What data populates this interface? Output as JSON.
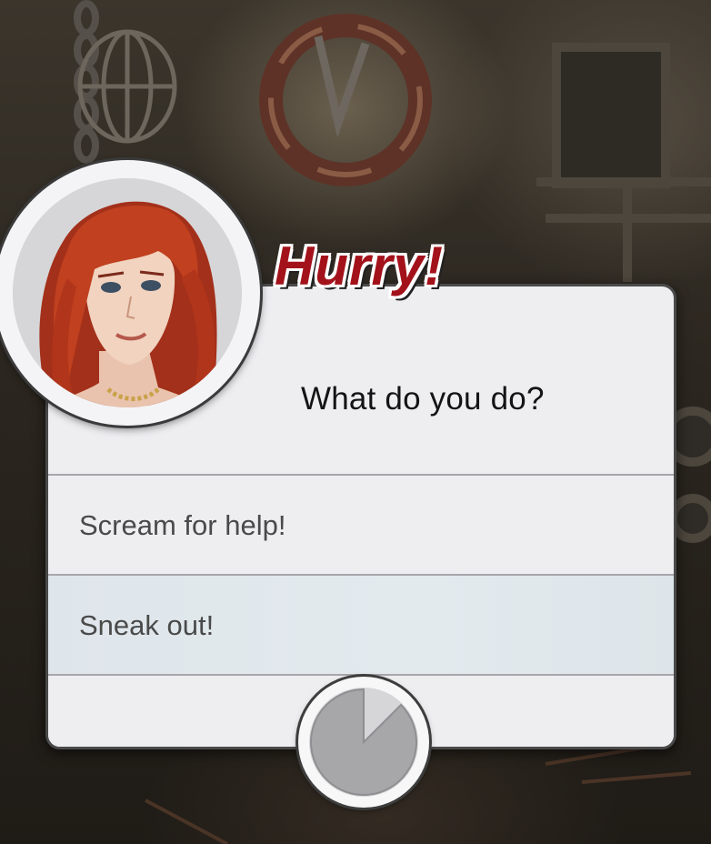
{
  "dialog": {
    "heading": "Hurry!",
    "question": "What do you do?",
    "options": [
      {
        "label": "Scream for help!"
      },
      {
        "label": "Sneak out!"
      }
    ],
    "timer_remaining_fraction": 0.875
  },
  "colors": {
    "heading_red": "#a3121a",
    "panel_bg": "#eeeef1",
    "highlight_option_bg": "#e0e7ec",
    "timer_gray": "#a7a7aa"
  },
  "icons": {
    "portrait": "character-portrait-red-hair",
    "timer": "countdown-pie-timer-icon"
  }
}
